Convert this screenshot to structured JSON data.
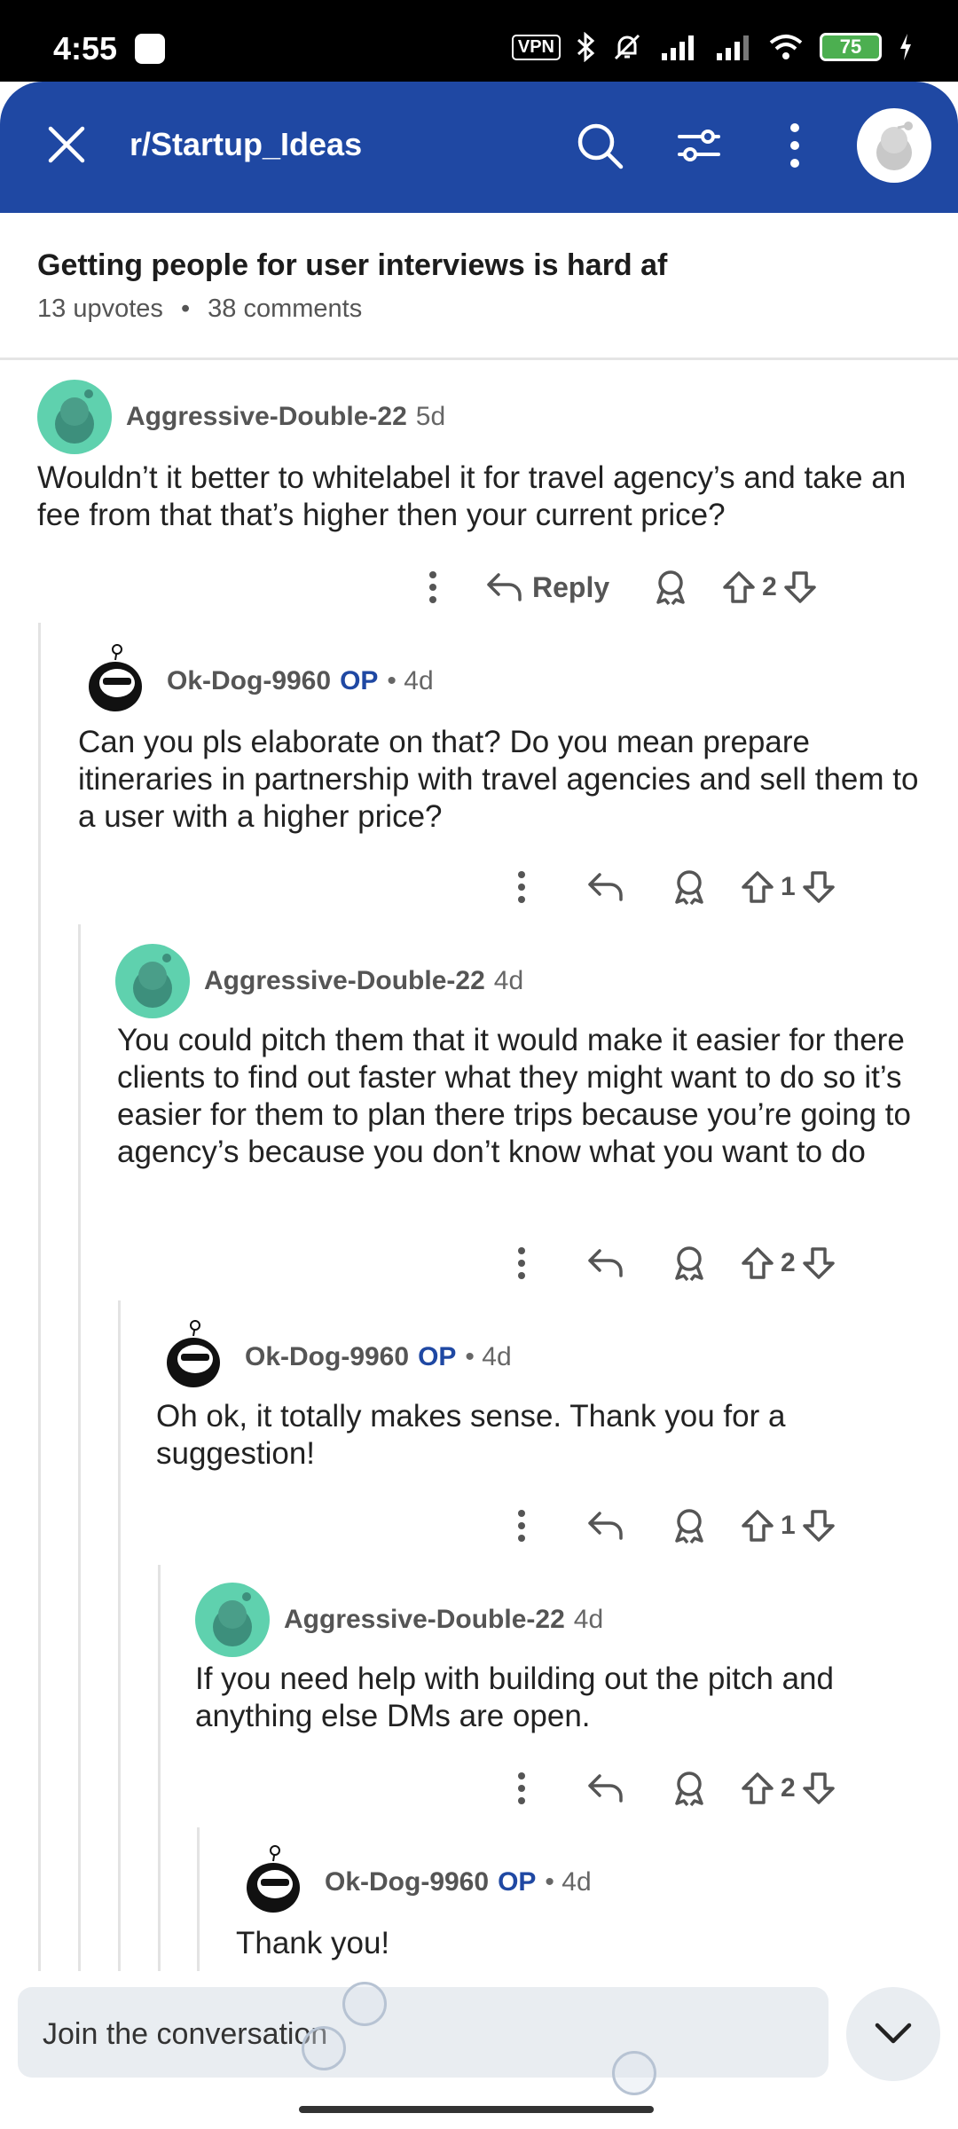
{
  "status": {
    "time": "4:55",
    "vpn": "VPN",
    "battery": "75"
  },
  "appbar": {
    "subreddit": "r/Startup_Ideas"
  },
  "post": {
    "title": "Getting people for user interviews is hard af",
    "upvotes": "13 upvotes",
    "separator": "•",
    "comments": "38 comments"
  },
  "comments": [
    {
      "author": "Aggressive-Double-22",
      "op": "",
      "time": "5d",
      "body": "Wouldn’t it better to whitelabel it for travel agency’s and take an fee from that that’s higher then your current price?",
      "reply_label": "Reply",
      "votes": "2"
    },
    {
      "author": "Ok-Dog-9960",
      "op": "OP",
      "time": "• 4d",
      "body": "Can you pls elaborate on that? Do you mean prepare itineraries in partnership with travel agencies and sell them to a user with a higher price?",
      "votes": "1"
    },
    {
      "author": "Aggressive-Double-22",
      "op": "",
      "time": "4d",
      "body": "You could pitch them that it would make it easier for there clients to find out faster what they might want to do so it’s easier for them to plan there trips because you’re going to agency’s because you don’t know what you want to do",
      "votes": "2"
    },
    {
      "author": "Ok-Dog-9960",
      "op": "OP",
      "time": "• 4d",
      "body": "Oh ok, it totally makes sense. Thank you for a suggestion!",
      "votes": "1"
    },
    {
      "author": "Aggressive-Double-22",
      "op": "",
      "time": "4d",
      "body": "If you need help with building out the pitch and anything else DMs are open.",
      "votes": "2"
    },
    {
      "author": "Ok-Dog-9960",
      "op": "OP",
      "time": "• 4d",
      "body": "Thank you!",
      "votes": ""
    }
  ],
  "bottom": {
    "placeholder": "Join the conversation"
  },
  "icons": [
    "close-icon",
    "search-icon",
    "filter-icon",
    "more-vertical-icon",
    "reply-icon",
    "award-icon",
    "upvote-icon",
    "downvote-icon",
    "chevron-down-icon"
  ]
}
